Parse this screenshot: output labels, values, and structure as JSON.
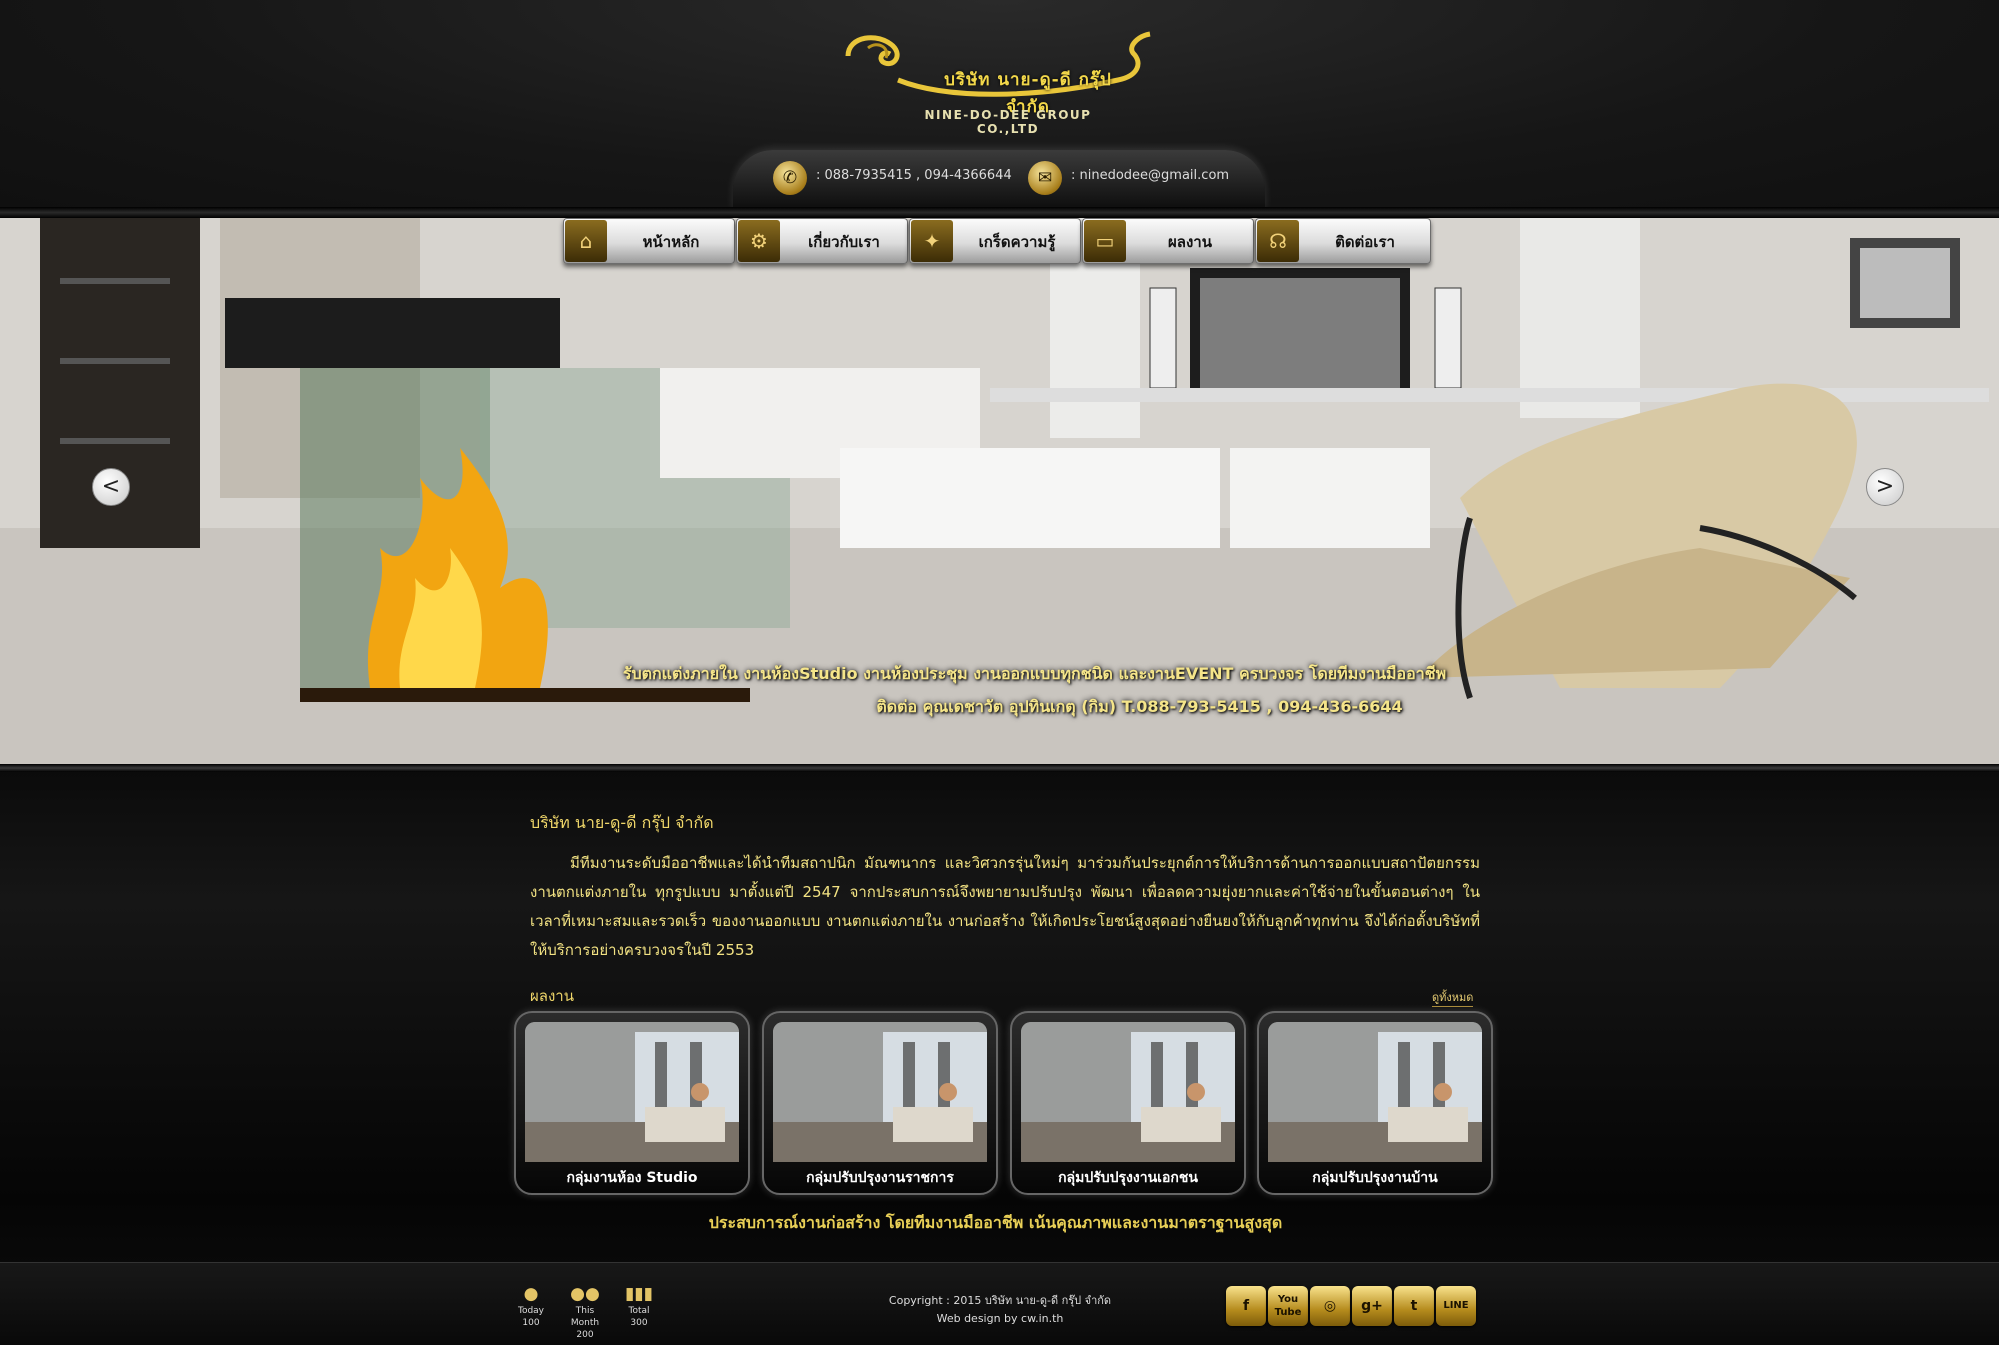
{
  "header": {
    "logo_thai": "บริษัท นาย-ดู-ดี กรุ๊ป จำกัด",
    "logo_english": "NINE-DO-DEE GROUP CO.,LTD",
    "phone_icon": "phone-icon",
    "phone_text": ": 088-7935415 , 094-4366644",
    "email_icon": "envelope-icon",
    "email_text": ": ninedodee@gmail.com"
  },
  "nav": {
    "items": [
      {
        "label": "หน้าหลัก",
        "icon": "home-icon"
      },
      {
        "label": "เกี่ยวกับเรา",
        "icon": "gears-icon"
      },
      {
        "label": "เกร็ดความรู้",
        "icon": "lightbulb-icon"
      },
      {
        "label": "ผลงาน",
        "icon": "folder-icon"
      },
      {
        "label": "ติดต่อเรา",
        "icon": "headset-icon"
      }
    ]
  },
  "slider": {
    "prev": "<",
    "next": ">",
    "caption_line1": "รับตกแต่งภายใน งานห้องStudio งานห้องประชุม งานออกแบบทุกชนิด และงานEVENT ครบวงจร โดยทีมงานมืออาชีพ",
    "caption_line2": "ติดต่อ คุณเดชาวัต อุปทินเกตุ (กิม) T.088-793-5415 , 094-436-6644"
  },
  "content": {
    "company_title": "บริษัท นาย-ดู-ดี กรุ๊ป จำกัด",
    "about": "มีทีมงานระดับมืออาชีพและได้นำทีมสถาปนิก มัณฑนากร และวิศวกรรุ่นใหม่ๆ มาร่วมกันประยุกต์การให้บริการด้านการออกแบบสถาปัตยกรรม งานตกแต่งภายใน ทุกรูปแบบ มาตั้งแต่ปี 2547 จากประสบการณ์จึงพยายามปรับปรุง พัฒนา เพื่อลดความยุ่งยากและค่าใช้จ่ายในขั้นตอนต่างๆ ในเวลาที่เหมาะสมและรวดเร็ว ของงานออกแบบ งานตกแต่งภายใน งานก่อสร้าง ให้เกิดประโยชน์สูงสุดอย่างยืนยงให้กับลูกค้าทุกท่าน จึงได้ก่อตั้งบริษัทที่ให้บริการอย่างครบวงจรในปี 2553",
    "works_title": "ผลงาน",
    "view_all": "ดูทั้งหมด",
    "works": [
      {
        "caption": "กลุ่มงานห้อง Studio"
      },
      {
        "caption": "กลุ่มปรับปรุงงานราชการ"
      },
      {
        "caption": "กลุ่มปรับปรุงงานเอกชน"
      },
      {
        "caption": "กลุ่มปรับปรุงงานบ้าน"
      }
    ],
    "tagline": "ประสบการณ์งานก่อสร้าง โดยทีมงานมืออาชีพ เน้นคุณภาพและงานมาตราฐานสูงสุด"
  },
  "footer": {
    "stats": [
      {
        "label": "Today",
        "value": "100",
        "icon": "user-icon"
      },
      {
        "label": "This Month",
        "value": "200",
        "icon": "users-icon"
      },
      {
        "label": "Total",
        "value": "300",
        "icon": "bar-chart-icon"
      }
    ],
    "copyright": "Copyright : 2015 บริษัท นาย-ดู-ดี กรุ๊ป จำกัด",
    "web_design": "Web design by cw.in.th",
    "social": [
      {
        "label": "f",
        "icon": "facebook-icon"
      },
      {
        "label": "You Tube",
        "icon": "youtube-icon"
      },
      {
        "label": "◎",
        "icon": "instagram-icon"
      },
      {
        "label": "g+",
        "icon": "google-plus-icon"
      },
      {
        "label": "t",
        "icon": "twitter-icon"
      },
      {
        "label": "LINE",
        "icon": "line-icon"
      }
    ]
  },
  "colors": {
    "gold": "#f0d76a",
    "background": "#0b0b0b",
    "nav_button": "#e6e6e6"
  }
}
